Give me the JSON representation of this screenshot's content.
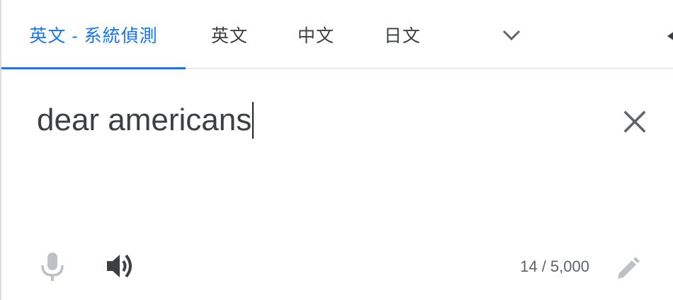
{
  "tabs": [
    {
      "label": "英文 - 系統偵測",
      "active": true
    },
    {
      "label": "英文",
      "active": false
    },
    {
      "label": "中文",
      "active": false
    },
    {
      "label": "日文",
      "active": false
    }
  ],
  "icons": {
    "more_languages": "chevron-down-icon",
    "swap": "arrow-left-icon",
    "clear": "close-icon",
    "voice": "microphone-icon",
    "listen": "speaker-icon",
    "edit": "pencil-icon"
  },
  "source": {
    "text": "dear americans"
  },
  "footer": {
    "char_count": "14 / 5,000"
  },
  "colors": {
    "accent": "#1a73e8",
    "text": "#3c4043",
    "muted": "#5f6368",
    "disabled": "#bdc1c6",
    "divider": "#dadce0"
  }
}
